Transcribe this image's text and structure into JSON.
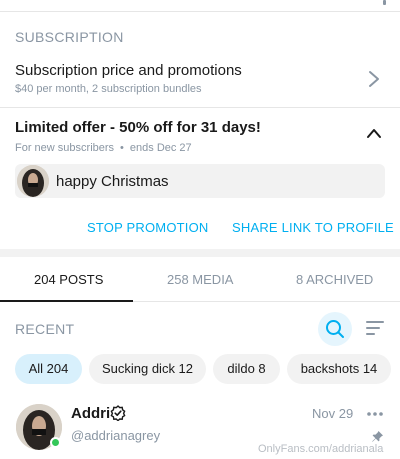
{
  "subscription": {
    "section_title": "SUBSCRIPTION",
    "price_row": {
      "title": "Subscription price and promotions",
      "subtitle": "$40 per month, 2 subscription bundles"
    }
  },
  "offer": {
    "title": "Limited offer - 50% off for 31 days!",
    "audience": "For new subscribers",
    "separator": "•",
    "ends": "ends Dec 27",
    "message": "happy Christmas",
    "stop_label": "STOP PROMOTION",
    "share_label": "SHARE LINK TO PROFILE"
  },
  "tabs": [
    {
      "label": "204 POSTS",
      "active": true
    },
    {
      "label": "258 MEDIA",
      "active": false
    },
    {
      "label": "8 ARCHIVED",
      "active": false
    }
  ],
  "recent": {
    "label": "RECENT"
  },
  "chips": [
    {
      "label": "All 204",
      "active": true
    },
    {
      "label": "Sucking dick 12",
      "active": false
    },
    {
      "label": "dildo 8",
      "active": false
    },
    {
      "label": "backshots 14",
      "active": false
    }
  ],
  "post": {
    "name": "Addri",
    "handle": "@addrianagrey",
    "date": "Nov 29"
  },
  "watermark": "OnlyFans.com/addrianala",
  "colors": {
    "accent": "#00aff0",
    "muted": "#8a96a3",
    "online": "#34c759"
  }
}
